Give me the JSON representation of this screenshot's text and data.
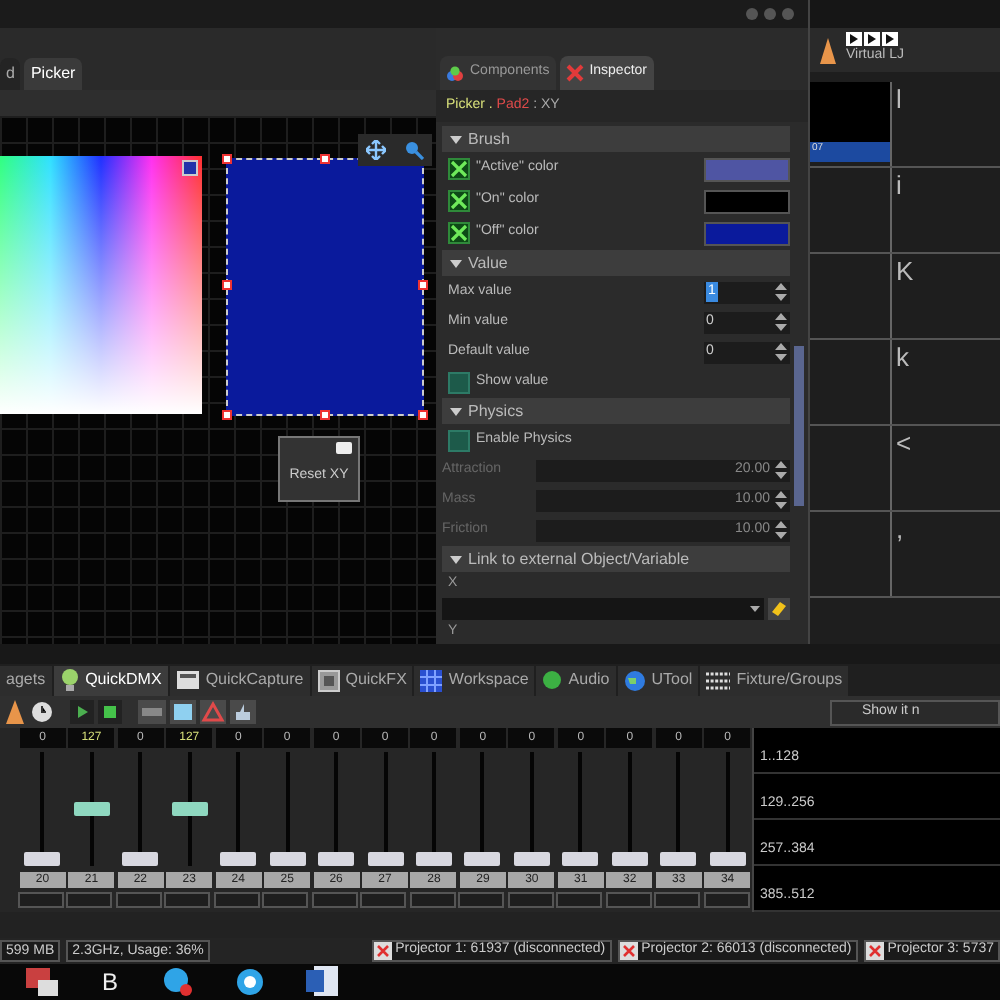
{
  "editor_tabs": [
    {
      "label": "d",
      "selected": false
    },
    {
      "label": "Picker",
      "selected": true
    }
  ],
  "canvas": {
    "reset_button": "Reset XY"
  },
  "inspector": {
    "tabs": [
      {
        "label": "Components",
        "selected": false
      },
      {
        "label": "Inspector",
        "selected": true
      }
    ],
    "path": {
      "object": "Picker",
      "separator": " . ",
      "pad": "Pad2",
      "property": " : XY"
    },
    "brush": {
      "title": "Brush",
      "rows": [
        {
          "label": "\"Active\" color",
          "checked": true,
          "color": "#4f55a3"
        },
        {
          "label": "\"On\" color",
          "checked": true,
          "color": "#000000"
        },
        {
          "label": "\"Off\" color",
          "checked": true,
          "color": "#0a1a9c"
        }
      ]
    },
    "value": {
      "title": "Value",
      "fields": [
        {
          "label": "Max value",
          "value": "1",
          "focused": true
        },
        {
          "label": "Min value",
          "value": "0",
          "focused": false
        },
        {
          "label": "Default value",
          "value": "0",
          "focused": false
        }
      ],
      "show_value": {
        "label": "Show value",
        "checked": false
      }
    },
    "physics": {
      "title": "Physics",
      "enable": {
        "label": "Enable Physics",
        "checked": false
      },
      "fields": [
        {
          "label": "Attraction",
          "value": "20.00",
          "disabled": true
        },
        {
          "label": "Mass",
          "value": "10.00",
          "disabled": true
        },
        {
          "label": "Friction",
          "value": "10.00",
          "disabled": true
        }
      ]
    },
    "link": {
      "title": "Link to external Object/Variable",
      "x_label": "X",
      "y_label": "Y"
    }
  },
  "virtual_panel": {
    "title": "Virtual LJ",
    "preview_label": "07",
    "rows": [
      "l",
      "i",
      "K",
      "k",
      "<",
      ","
    ]
  },
  "bottom_tabs": [
    {
      "label": "agets",
      "selected": false,
      "kind": "plain"
    },
    {
      "label": "QuickDMX",
      "selected": true,
      "kind": "bulb"
    },
    {
      "label": "QuickCapture",
      "selected": false,
      "kind": "screen"
    },
    {
      "label": "QuickFX",
      "selected": false,
      "kind": "panel"
    },
    {
      "label": "Workspace",
      "selected": false,
      "kind": "grid"
    },
    {
      "label": "Audio",
      "selected": false,
      "kind": "audio"
    },
    {
      "label": "UTool",
      "selected": false,
      "kind": "globe"
    },
    {
      "label": "Fixture/Groups",
      "selected": false,
      "kind": "list"
    }
  ],
  "show_button": "Show it n",
  "channels": [
    {
      "number": "20",
      "value": "0",
      "level": 0
    },
    {
      "number": "21",
      "value": "127",
      "level": 0.5
    },
    {
      "number": "22",
      "value": "0",
      "level": 0
    },
    {
      "number": "23",
      "value": "127",
      "level": 0.5
    },
    {
      "number": "24",
      "value": "0",
      "level": 0
    },
    {
      "number": "25",
      "value": "0",
      "level": 0
    },
    {
      "number": "26",
      "value": "0",
      "level": 0
    },
    {
      "number": "27",
      "value": "0",
      "level": 0
    },
    {
      "number": "28",
      "value": "0",
      "level": 0
    },
    {
      "number": "29",
      "value": "0",
      "level": 0
    },
    {
      "number": "30",
      "value": "0",
      "level": 0
    },
    {
      "number": "31",
      "value": "0",
      "level": 0
    },
    {
      "number": "32",
      "value": "0",
      "level": 0
    },
    {
      "number": "33",
      "value": "0",
      "level": 0
    },
    {
      "number": "34",
      "value": "0",
      "level": 0
    }
  ],
  "universes": [
    "1..128",
    "129..256",
    "257..384",
    "385..512"
  ],
  "status_bar": {
    "memory": "599 MB",
    "cpu": "2.3GHz, Usage: 36%",
    "projectors": [
      "Projector 1: 61937 (disconnected)",
      "Projector 2: 66013 (disconnected)",
      "Projector 3: 5737"
    ]
  },
  "taskbar": [
    {
      "kind": "app"
    },
    {
      "kind": "letter",
      "label": "B"
    },
    {
      "kind": "chat"
    },
    {
      "kind": "chat2"
    },
    {
      "kind": "word"
    }
  ]
}
